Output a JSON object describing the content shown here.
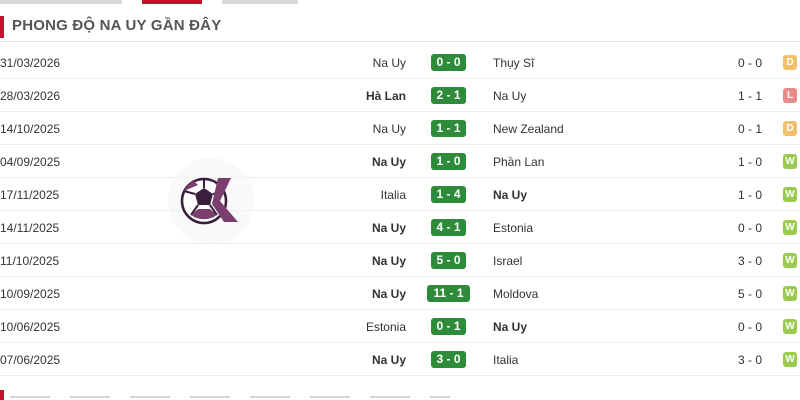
{
  "header": {
    "title": "PHONG ĐỘ NA UY GẦN ĐÂY"
  },
  "brand": {
    "accent": "#c8102e",
    "score_bg": "#2e8b3a",
    "win": "#9acb4f",
    "draw": "#f2bf6b",
    "loss": "#e88a86"
  },
  "logo": {
    "icon": "soccer-ball-k-logo"
  },
  "matches": [
    {
      "date": "31/03/2026",
      "home": "Na Uy",
      "home_bold": false,
      "score": "0 - 0",
      "away": "Thụy Sĩ",
      "away_bold": false,
      "ht": "0 - 0",
      "result": "D",
      "result_type": "d"
    },
    {
      "date": "28/03/2026",
      "home": "Hà Lan",
      "home_bold": true,
      "score": "2 - 1",
      "away": "Na Uy",
      "away_bold": false,
      "ht": "1 - 1",
      "result": "L",
      "result_type": "l"
    },
    {
      "date": "14/10/2025",
      "home": "Na Uy",
      "home_bold": false,
      "score": "1 - 1",
      "away": "New Zealand",
      "away_bold": false,
      "ht": "0 - 1",
      "result": "D",
      "result_type": "d"
    },
    {
      "date": "04/09/2025",
      "home": "Na Uy",
      "home_bold": true,
      "score": "1 - 0",
      "away": "Phần Lan",
      "away_bold": false,
      "ht": "1 - 0",
      "result": "W",
      "result_type": "w"
    },
    {
      "date": "17/11/2025",
      "home": "Italia",
      "home_bold": false,
      "score": "1 - 4",
      "away": "Na Uy",
      "away_bold": true,
      "ht": "1 - 0",
      "result": "W",
      "result_type": "w"
    },
    {
      "date": "14/11/2025",
      "home": "Na Uy",
      "home_bold": true,
      "score": "4 - 1",
      "away": "Estonia",
      "away_bold": false,
      "ht": "0 - 0",
      "result": "W",
      "result_type": "w"
    },
    {
      "date": "11/10/2025",
      "home": "Na Uy",
      "home_bold": true,
      "score": "5 - 0",
      "away": "Israel",
      "away_bold": false,
      "ht": "3 - 0",
      "result": "W",
      "result_type": "w"
    },
    {
      "date": "10/09/2025",
      "home": "Na Uy",
      "home_bold": true,
      "score": "11 - 1",
      "away": "Moldova",
      "away_bold": false,
      "ht": "5 - 0",
      "result": "W",
      "result_type": "w"
    },
    {
      "date": "10/06/2025",
      "home": "Estonia",
      "home_bold": false,
      "score": "0 - 1",
      "away": "Na Uy",
      "away_bold": true,
      "ht": "0 - 0",
      "result": "W",
      "result_type": "w"
    },
    {
      "date": "07/06/2025",
      "home": "Na Uy",
      "home_bold": true,
      "score": "3 - 0",
      "away": "Italia",
      "away_bold": false,
      "ht": "3 - 0",
      "result": "W",
      "result_type": "w"
    }
  ]
}
